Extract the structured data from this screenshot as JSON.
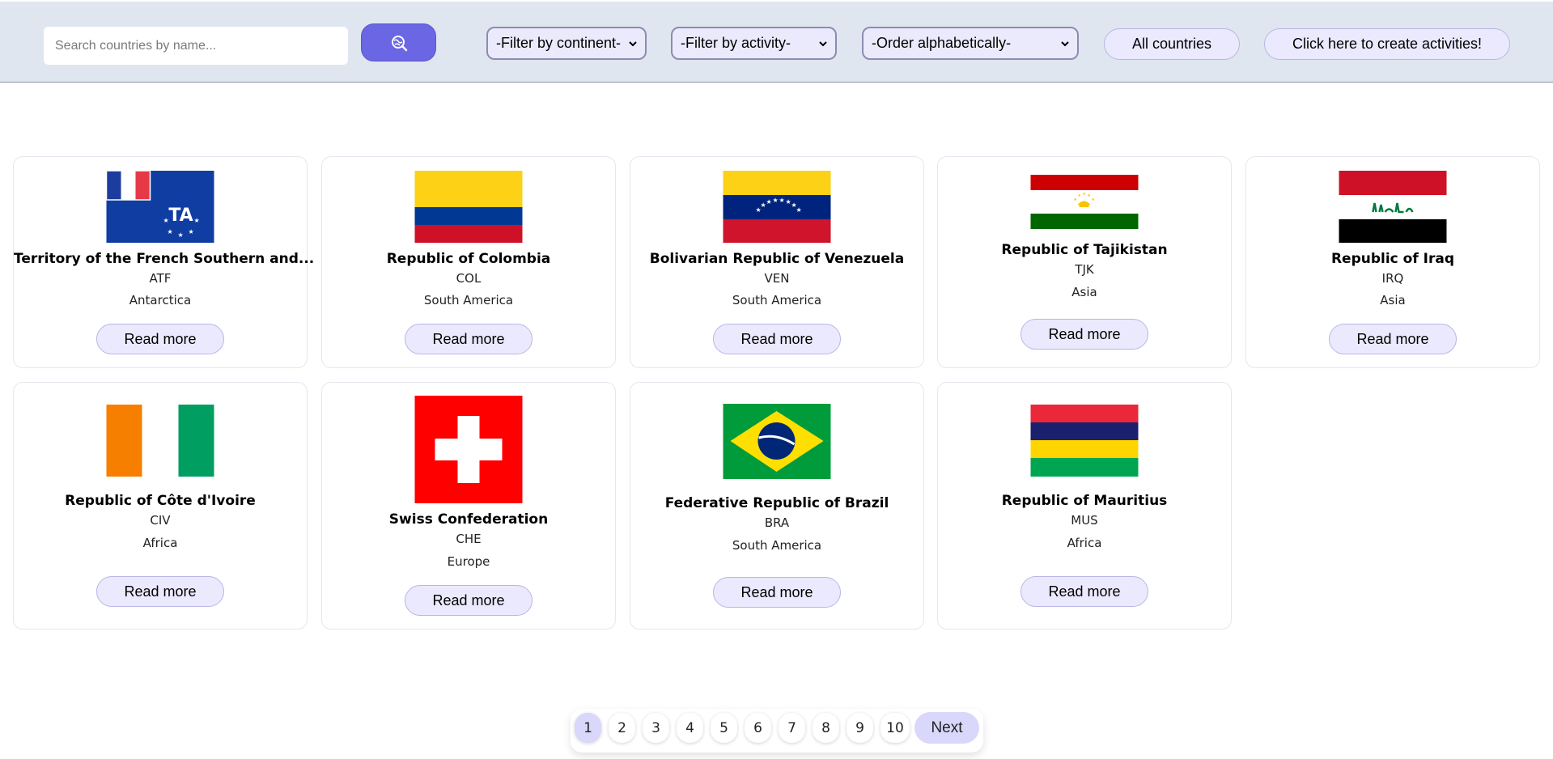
{
  "toolbar": {
    "search_placeholder": "Search countries by name...",
    "search_icon": "search-globe-icon",
    "continent_filter": "-Filter by continent-",
    "activity_filter": "-Filter by activity-",
    "order_select": "-Order alphabetically-",
    "all_countries_label": "All countries",
    "create_activities_label": "Click here to create activities!"
  },
  "colors": {
    "topbar_bg": "#dfe6ef",
    "search_button": "#6a66e4",
    "pill_bg": "#ebe9fd",
    "pager_active": "#d9d7fa"
  },
  "countries": [
    {
      "name": "Territory of the French Southern and...",
      "code": "ATF",
      "continent": "Antarctica",
      "button": "Read more",
      "flag": "french-southern-territories-flag"
    },
    {
      "name": "Republic of Colombia",
      "code": "COL",
      "continent": "South America",
      "button": "Read more",
      "flag": "colombia-flag"
    },
    {
      "name": "Bolivarian Republic of Venezuela",
      "code": "VEN",
      "continent": "South America",
      "button": "Read more",
      "flag": "venezuela-flag"
    },
    {
      "name": "Republic of Tajikistan",
      "code": "TJK",
      "continent": "Asia",
      "button": "Read more",
      "flag": "tajikistan-flag"
    },
    {
      "name": "Republic of Iraq",
      "code": "IRQ",
      "continent": "Asia",
      "button": "Read more",
      "flag": "iraq-flag"
    },
    {
      "name": "Republic of Côte d'Ivoire",
      "code": "CIV",
      "continent": "Africa",
      "button": "Read more",
      "flag": "cote-divoire-flag"
    },
    {
      "name": "Swiss Confederation",
      "code": "CHE",
      "continent": "Europe",
      "button": "Read more",
      "flag": "switzerland-flag"
    },
    {
      "name": "Federative Republic of Brazil",
      "code": "BRA",
      "continent": "South America",
      "button": "Read more",
      "flag": "brazil-flag"
    },
    {
      "name": "Republic of Mauritius",
      "code": "MUS",
      "continent": "Africa",
      "button": "Read more",
      "flag": "mauritius-flag"
    }
  ],
  "pagination": {
    "pages": [
      "1",
      "2",
      "3",
      "4",
      "5",
      "6",
      "7",
      "8",
      "9",
      "10"
    ],
    "current": "1",
    "next_label": "Next"
  }
}
